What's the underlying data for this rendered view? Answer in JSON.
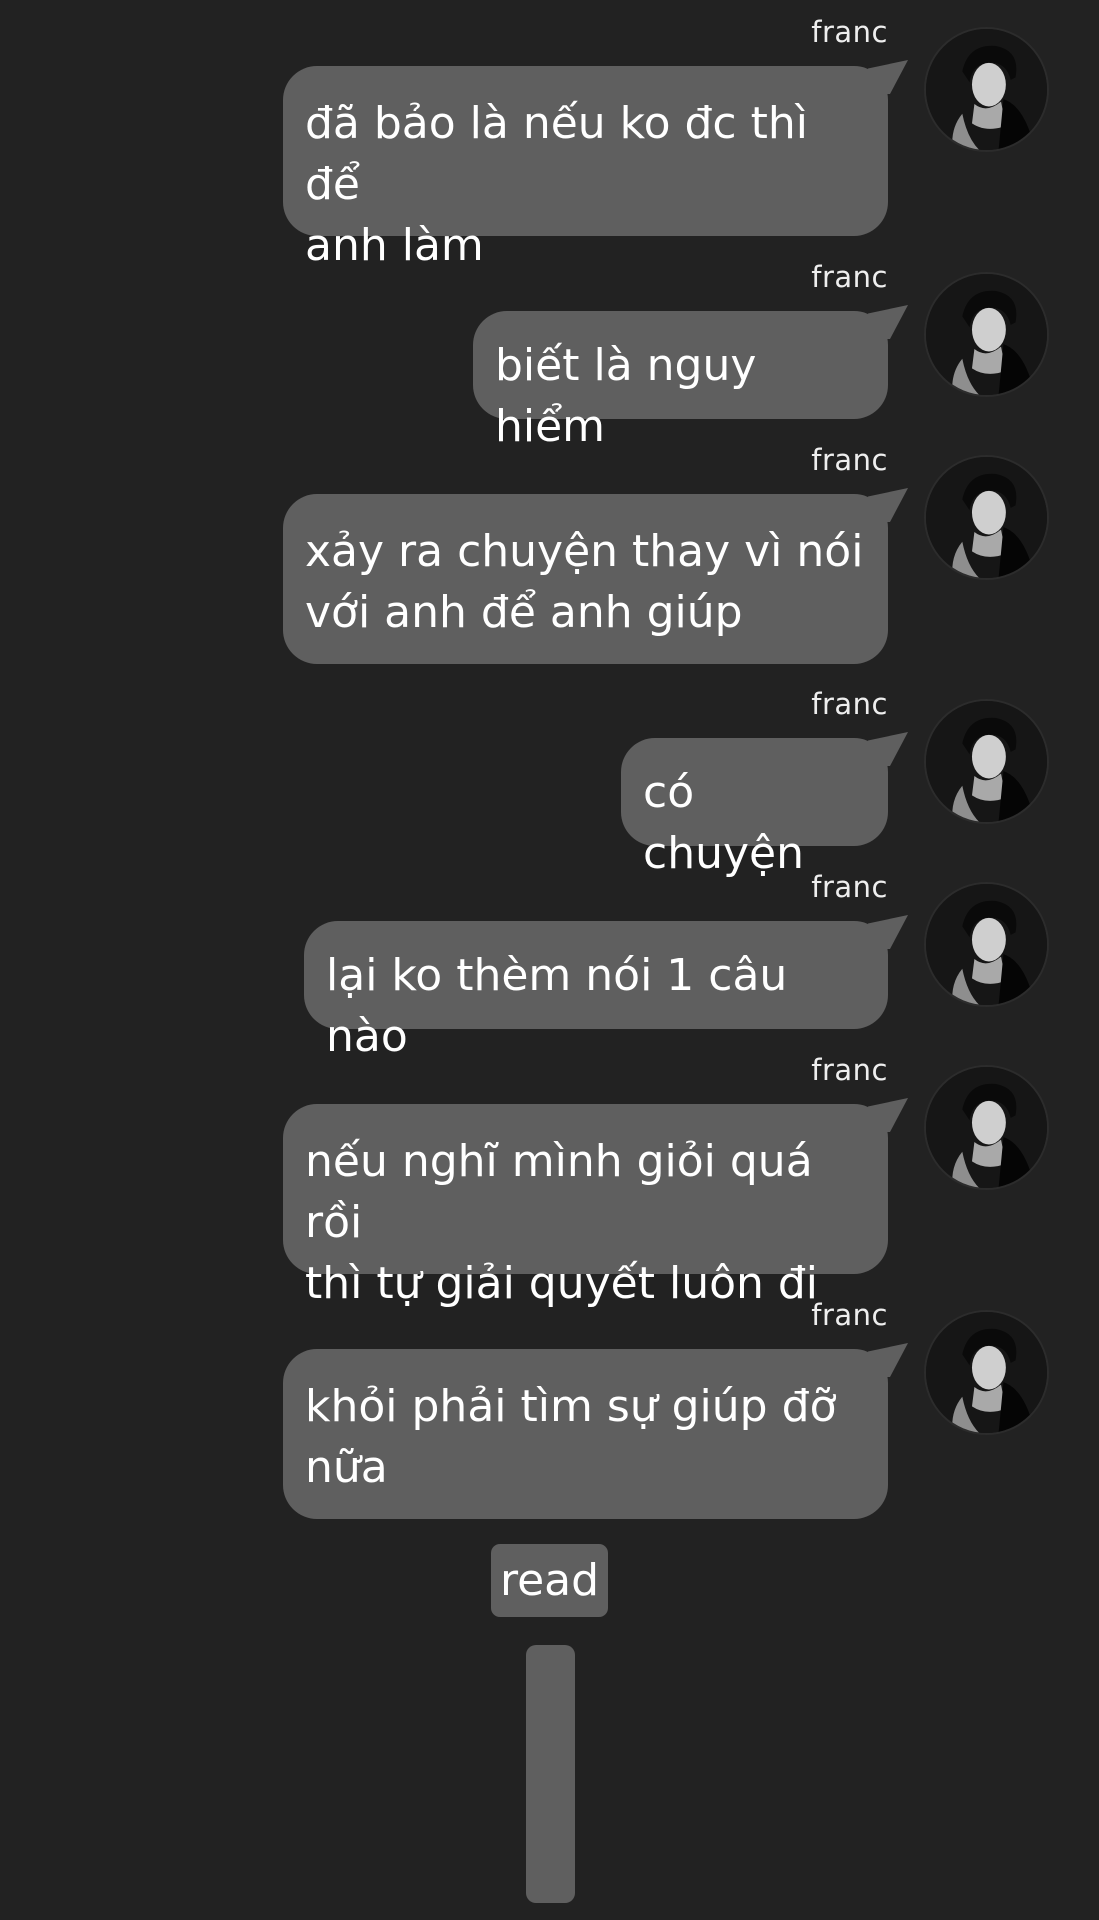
{
  "conversation": {
    "messages": [
      {
        "sender": "franc",
        "text": "đã bảo là nếu ko đc thì để\nanh làm"
      },
      {
        "sender": "franc",
        "text": "biết là nguy hiểm"
      },
      {
        "sender": "franc",
        "text": "xảy ra chuyện thay vì nói\nvới anh để anh giúp"
      },
      {
        "sender": "franc",
        "text": "có chuyện"
      },
      {
        "sender": "franc",
        "text": "lại ko thèm nói 1 câu nào"
      },
      {
        "sender": "franc",
        "text": "nếu nghĩ mình giỏi quá rồi\nthì tự giải quyết luôn đi"
      },
      {
        "sender": "franc",
        "text": "khỏi phải tìm sự giúp đỡ\nnữa"
      }
    ],
    "read_label": "read"
  },
  "colors": {
    "background": "#222222",
    "bubble": "#5f5f5f",
    "text": "#ffffff"
  },
  "icons": {
    "avatar": "profile-photo-avatar"
  }
}
